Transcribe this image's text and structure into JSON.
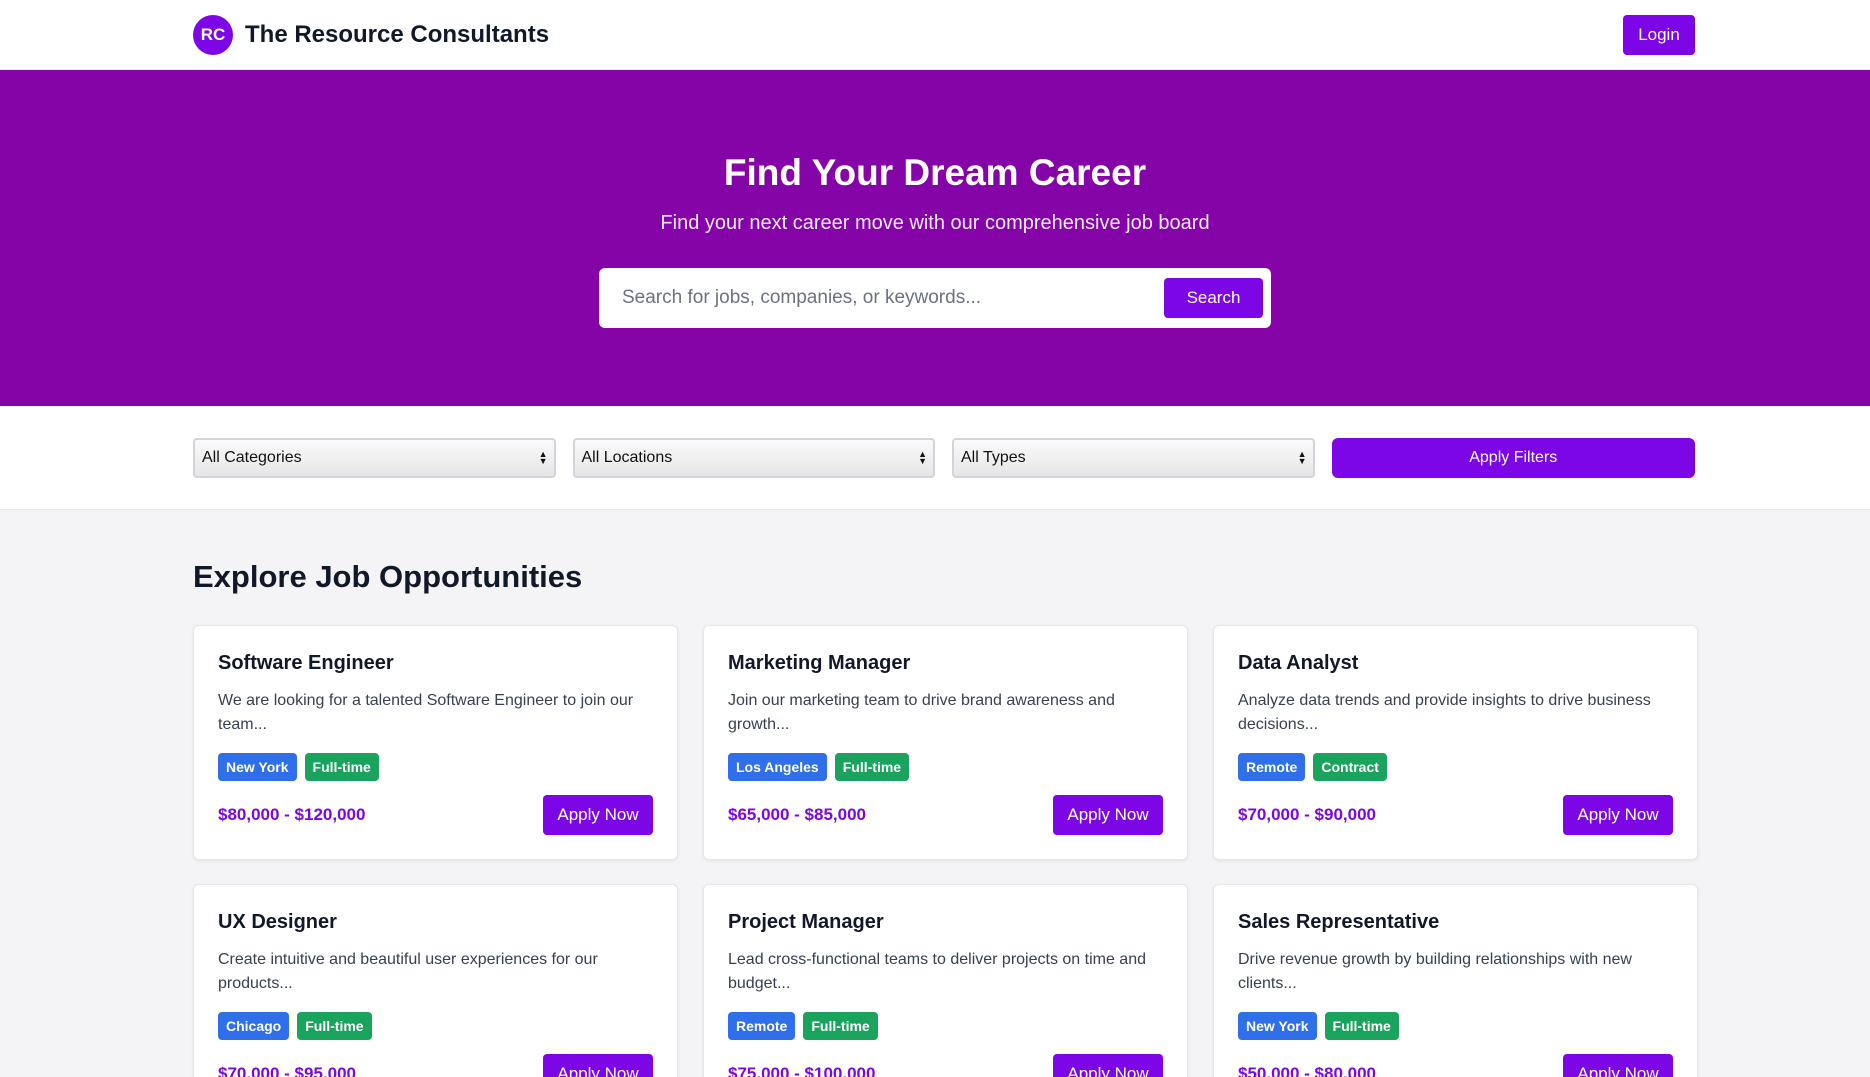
{
  "header": {
    "logo_text": "RC",
    "brand_name": "The Resource Consultants",
    "login_label": "Login"
  },
  "hero": {
    "title": "Find Your Dream Career",
    "subtitle": "Find your next career move with our comprehensive job board",
    "search_placeholder": "Search for jobs, companies, or keywords...",
    "search_label": "Search"
  },
  "filters": {
    "category": "All Categories",
    "location": "All Locations",
    "type": "All Types",
    "apply_label": "Apply Filters"
  },
  "main": {
    "section_title": "Explore Job Opportunities",
    "apply_label": "Apply Now",
    "jobs": [
      {
        "title": "Software Engineer",
        "description": "We are looking for a talented Software Engineer to join our team...",
        "location": "New York",
        "type": "Full-time",
        "salary": "$80,000 - $120,000"
      },
      {
        "title": "Marketing Manager",
        "description": "Join our marketing team to drive brand awareness and growth...",
        "location": "Los Angeles",
        "type": "Full-time",
        "salary": "$65,000 - $85,000"
      },
      {
        "title": "Data Analyst",
        "description": "Analyze data trends and provide insights to drive business decisions...",
        "location": "Remote",
        "type": "Contract",
        "salary": "$70,000 - $90,000"
      },
      {
        "title": "UX Designer",
        "description": "Create intuitive and beautiful user experiences for our products...",
        "location": "Chicago",
        "type": "Full-time",
        "salary": "$70,000 - $95,000"
      },
      {
        "title": "Project Manager",
        "description": "Lead cross-functional teams to deliver projects on time and budget...",
        "location": "Remote",
        "type": "Full-time",
        "salary": "$75,000 - $100,000"
      },
      {
        "title": "Sales Representative",
        "description": "Drive revenue growth by building relationships with new clients...",
        "location": "New York",
        "type": "Full-time",
        "salary": "$50,000 - $80,000"
      }
    ]
  },
  "colors": {
    "accent": "#7c06e6",
    "hero_bg": "#8504a8",
    "location_tag": "#2f6fe9",
    "type_tag": "#1aa35c"
  }
}
